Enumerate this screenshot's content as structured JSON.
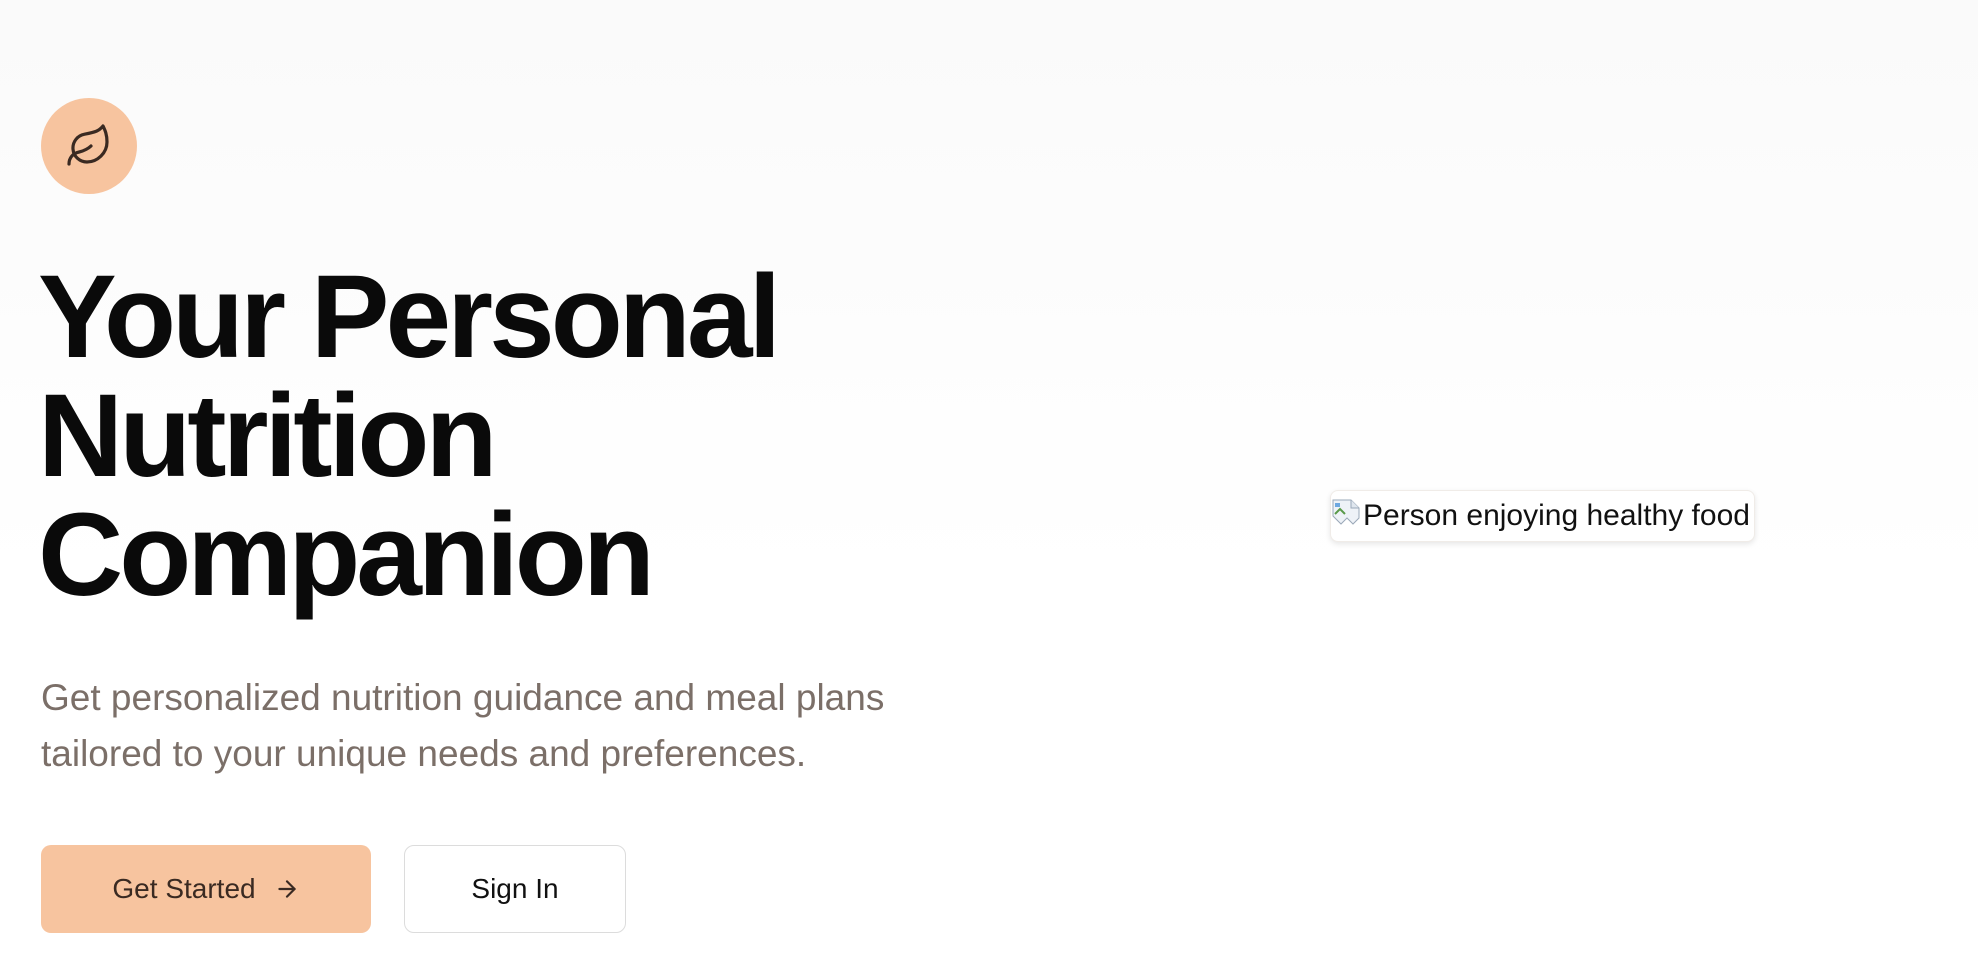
{
  "hero": {
    "logo_icon": "leaf-icon",
    "title_lines": [
      "Your Personal",
      "Nutrition",
      "Companion"
    ],
    "subtitle_lines": [
      "Get personalized nutrition guidance and meal plans",
      "tailored to your unique needs and preferences."
    ],
    "primary_button": {
      "label": "Get Started",
      "icon": "arrow-right-icon"
    },
    "secondary_button": {
      "label": "Sign In"
    },
    "image": {
      "alt": "Person enjoying healthy food",
      "icon": "broken-image-icon"
    }
  },
  "colors": {
    "accent": "#f7c49f",
    "title": "#0a0a0a",
    "subtitle": "#7b6f68",
    "button_text_primary": "#3a2a22"
  }
}
